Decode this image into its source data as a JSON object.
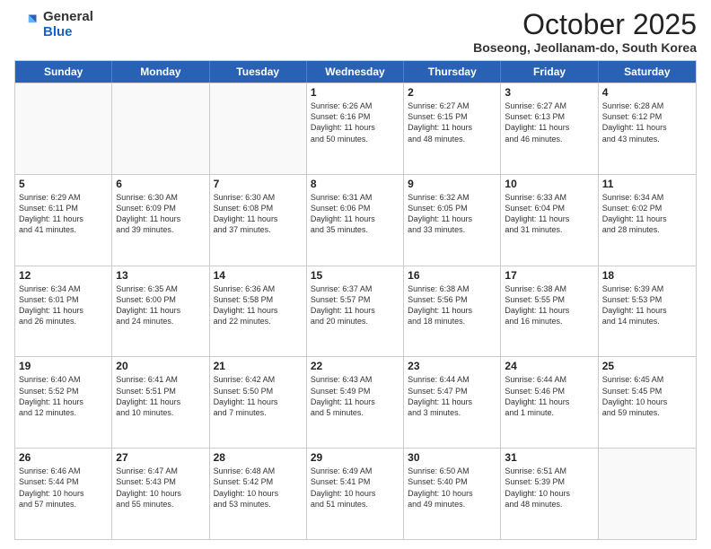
{
  "header": {
    "logo_general": "General",
    "logo_blue": "Blue",
    "month_title": "October 2025",
    "location": "Boseong, Jeollanam-do, South Korea"
  },
  "days_of_week": [
    "Sunday",
    "Monday",
    "Tuesday",
    "Wednesday",
    "Thursday",
    "Friday",
    "Saturday"
  ],
  "weeks": [
    [
      {
        "day": "",
        "info": ""
      },
      {
        "day": "",
        "info": ""
      },
      {
        "day": "",
        "info": ""
      },
      {
        "day": "1",
        "info": "Sunrise: 6:26 AM\nSunset: 6:16 PM\nDaylight: 11 hours\nand 50 minutes."
      },
      {
        "day": "2",
        "info": "Sunrise: 6:27 AM\nSunset: 6:15 PM\nDaylight: 11 hours\nand 48 minutes."
      },
      {
        "day": "3",
        "info": "Sunrise: 6:27 AM\nSunset: 6:13 PM\nDaylight: 11 hours\nand 46 minutes."
      },
      {
        "day": "4",
        "info": "Sunrise: 6:28 AM\nSunset: 6:12 PM\nDaylight: 11 hours\nand 43 minutes."
      }
    ],
    [
      {
        "day": "5",
        "info": "Sunrise: 6:29 AM\nSunset: 6:11 PM\nDaylight: 11 hours\nand 41 minutes."
      },
      {
        "day": "6",
        "info": "Sunrise: 6:30 AM\nSunset: 6:09 PM\nDaylight: 11 hours\nand 39 minutes."
      },
      {
        "day": "7",
        "info": "Sunrise: 6:30 AM\nSunset: 6:08 PM\nDaylight: 11 hours\nand 37 minutes."
      },
      {
        "day": "8",
        "info": "Sunrise: 6:31 AM\nSunset: 6:06 PM\nDaylight: 11 hours\nand 35 minutes."
      },
      {
        "day": "9",
        "info": "Sunrise: 6:32 AM\nSunset: 6:05 PM\nDaylight: 11 hours\nand 33 minutes."
      },
      {
        "day": "10",
        "info": "Sunrise: 6:33 AM\nSunset: 6:04 PM\nDaylight: 11 hours\nand 31 minutes."
      },
      {
        "day": "11",
        "info": "Sunrise: 6:34 AM\nSunset: 6:02 PM\nDaylight: 11 hours\nand 28 minutes."
      }
    ],
    [
      {
        "day": "12",
        "info": "Sunrise: 6:34 AM\nSunset: 6:01 PM\nDaylight: 11 hours\nand 26 minutes."
      },
      {
        "day": "13",
        "info": "Sunrise: 6:35 AM\nSunset: 6:00 PM\nDaylight: 11 hours\nand 24 minutes."
      },
      {
        "day": "14",
        "info": "Sunrise: 6:36 AM\nSunset: 5:58 PM\nDaylight: 11 hours\nand 22 minutes."
      },
      {
        "day": "15",
        "info": "Sunrise: 6:37 AM\nSunset: 5:57 PM\nDaylight: 11 hours\nand 20 minutes."
      },
      {
        "day": "16",
        "info": "Sunrise: 6:38 AM\nSunset: 5:56 PM\nDaylight: 11 hours\nand 18 minutes."
      },
      {
        "day": "17",
        "info": "Sunrise: 6:38 AM\nSunset: 5:55 PM\nDaylight: 11 hours\nand 16 minutes."
      },
      {
        "day": "18",
        "info": "Sunrise: 6:39 AM\nSunset: 5:53 PM\nDaylight: 11 hours\nand 14 minutes."
      }
    ],
    [
      {
        "day": "19",
        "info": "Sunrise: 6:40 AM\nSunset: 5:52 PM\nDaylight: 11 hours\nand 12 minutes."
      },
      {
        "day": "20",
        "info": "Sunrise: 6:41 AM\nSunset: 5:51 PM\nDaylight: 11 hours\nand 10 minutes."
      },
      {
        "day": "21",
        "info": "Sunrise: 6:42 AM\nSunset: 5:50 PM\nDaylight: 11 hours\nand 7 minutes."
      },
      {
        "day": "22",
        "info": "Sunrise: 6:43 AM\nSunset: 5:49 PM\nDaylight: 11 hours\nand 5 minutes."
      },
      {
        "day": "23",
        "info": "Sunrise: 6:44 AM\nSunset: 5:47 PM\nDaylight: 11 hours\nand 3 minutes."
      },
      {
        "day": "24",
        "info": "Sunrise: 6:44 AM\nSunset: 5:46 PM\nDaylight: 11 hours\nand 1 minute."
      },
      {
        "day": "25",
        "info": "Sunrise: 6:45 AM\nSunset: 5:45 PM\nDaylight: 10 hours\nand 59 minutes."
      }
    ],
    [
      {
        "day": "26",
        "info": "Sunrise: 6:46 AM\nSunset: 5:44 PM\nDaylight: 10 hours\nand 57 minutes."
      },
      {
        "day": "27",
        "info": "Sunrise: 6:47 AM\nSunset: 5:43 PM\nDaylight: 10 hours\nand 55 minutes."
      },
      {
        "day": "28",
        "info": "Sunrise: 6:48 AM\nSunset: 5:42 PM\nDaylight: 10 hours\nand 53 minutes."
      },
      {
        "day": "29",
        "info": "Sunrise: 6:49 AM\nSunset: 5:41 PM\nDaylight: 10 hours\nand 51 minutes."
      },
      {
        "day": "30",
        "info": "Sunrise: 6:50 AM\nSunset: 5:40 PM\nDaylight: 10 hours\nand 49 minutes."
      },
      {
        "day": "31",
        "info": "Sunrise: 6:51 AM\nSunset: 5:39 PM\nDaylight: 10 hours\nand 48 minutes."
      },
      {
        "day": "",
        "info": ""
      }
    ]
  ]
}
